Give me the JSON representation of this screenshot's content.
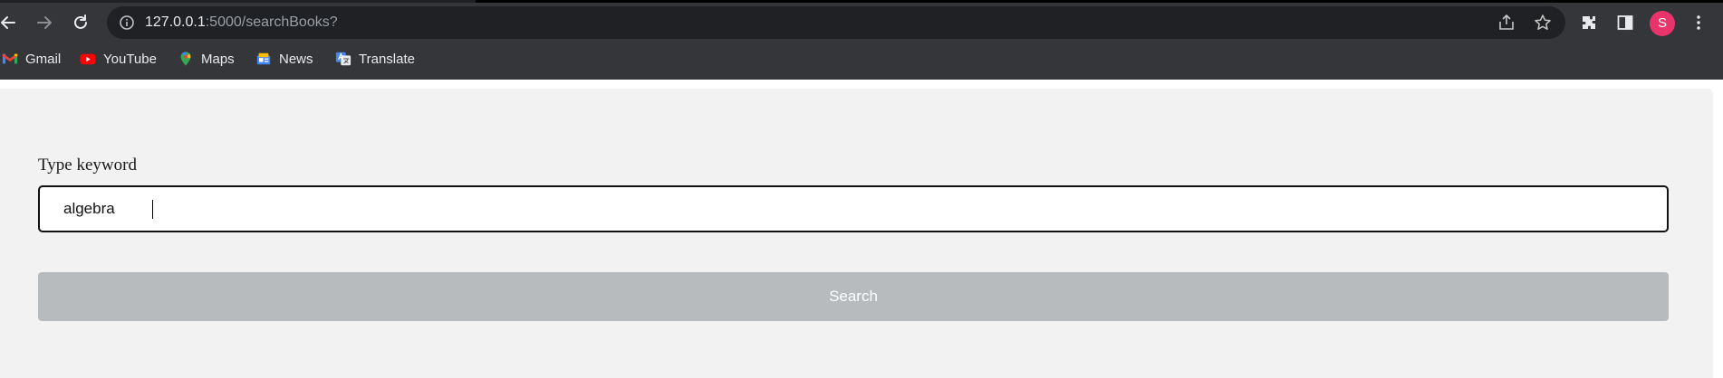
{
  "browser": {
    "url_host": "127.0.0.1",
    "url_rest": ":5000/searchBooks?",
    "profile_initial": "S",
    "avatar_color": "#e8336b",
    "icons": [
      "back-icon",
      "forward-icon",
      "reload-icon",
      "info-icon",
      "share-icon",
      "star-icon",
      "extensions-icon",
      "side-panel-icon",
      "kebab-menu-icon"
    ]
  },
  "bookmarks": [
    {
      "label": "Gmail",
      "icon": "gmail-icon"
    },
    {
      "label": "YouTube",
      "icon": "youtube-icon"
    },
    {
      "label": "Maps",
      "icon": "maps-icon"
    },
    {
      "label": "News",
      "icon": "news-icon"
    },
    {
      "label": "Translate",
      "icon": "translate-icon"
    }
  ],
  "form": {
    "label": "Type keyword",
    "keyword_value": "algebra",
    "search_label": "Search",
    "button_color": "#b8bbbe"
  }
}
